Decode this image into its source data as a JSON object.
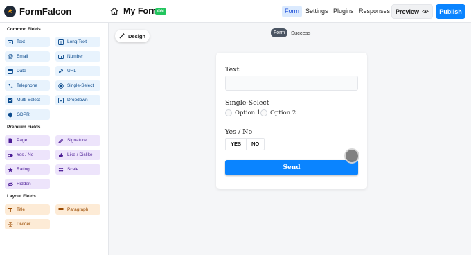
{
  "app": {
    "name": "FormFalcon"
  },
  "header": {
    "form_title": "My Form",
    "status_badge": "ON",
    "nav": [
      "Form",
      "Settings",
      "Plugins",
      "Responses"
    ],
    "active_nav": "Form",
    "preview_label": "Preview",
    "publish_label": "Publish"
  },
  "sidebar": {
    "common_title": "Common Fields",
    "common_fields": [
      {
        "label": "Text",
        "icon": "text-field-icon"
      },
      {
        "label": "Long Text",
        "icon": "long-text-icon"
      },
      {
        "label": "Email",
        "icon": "at-icon"
      },
      {
        "label": "Number",
        "icon": "number-icon"
      },
      {
        "label": "Date",
        "icon": "calendar-icon"
      },
      {
        "label": "URL",
        "icon": "link-icon"
      },
      {
        "label": "Telephone",
        "icon": "phone-icon"
      },
      {
        "label": "Single-Select",
        "icon": "radio-icon"
      },
      {
        "label": "Multi-Select",
        "icon": "checkbox-icon"
      },
      {
        "label": "Dropdown",
        "icon": "dropdown-icon"
      },
      {
        "label": "GDPR",
        "icon": "shield-icon"
      }
    ],
    "premium_title": "Premium Fields",
    "premium_fields": [
      {
        "label": "Page",
        "icon": "page-icon"
      },
      {
        "label": "Signature",
        "icon": "signature-icon"
      },
      {
        "label": "Yes / No",
        "icon": "toggle-icon"
      },
      {
        "label": "Like / Dislike",
        "icon": "thumbs-icon"
      },
      {
        "label": "Rating",
        "icon": "star-icon"
      },
      {
        "label": "Scale",
        "icon": "scale-icon"
      },
      {
        "label": "Hidden",
        "icon": "eye-off-icon"
      }
    ],
    "layout_title": "Layout Fields",
    "layout_fields": [
      {
        "label": "Title",
        "icon": "title-icon"
      },
      {
        "label": "Paragraph",
        "icon": "paragraph-icon"
      },
      {
        "label": "Divider",
        "icon": "divider-icon"
      }
    ]
  },
  "canvas": {
    "design_label": "Design",
    "tabs": [
      "Form",
      "Success"
    ],
    "active_tab": "Form"
  },
  "form": {
    "text_label": "Text",
    "text_value": "",
    "single_select_label": "Single-Select",
    "options": [
      "Option 1",
      "Option 2"
    ],
    "yes_no_label": "Yes / No",
    "yes_label": "YES",
    "no_label": "NO",
    "send_label": "Send"
  },
  "colors": {
    "accent": "#0a84ff",
    "badge_green": "#22c55e",
    "common_bg": "#e8f3fd",
    "premium_bg": "#ede4fb",
    "layout_bg": "#fdebd6"
  }
}
